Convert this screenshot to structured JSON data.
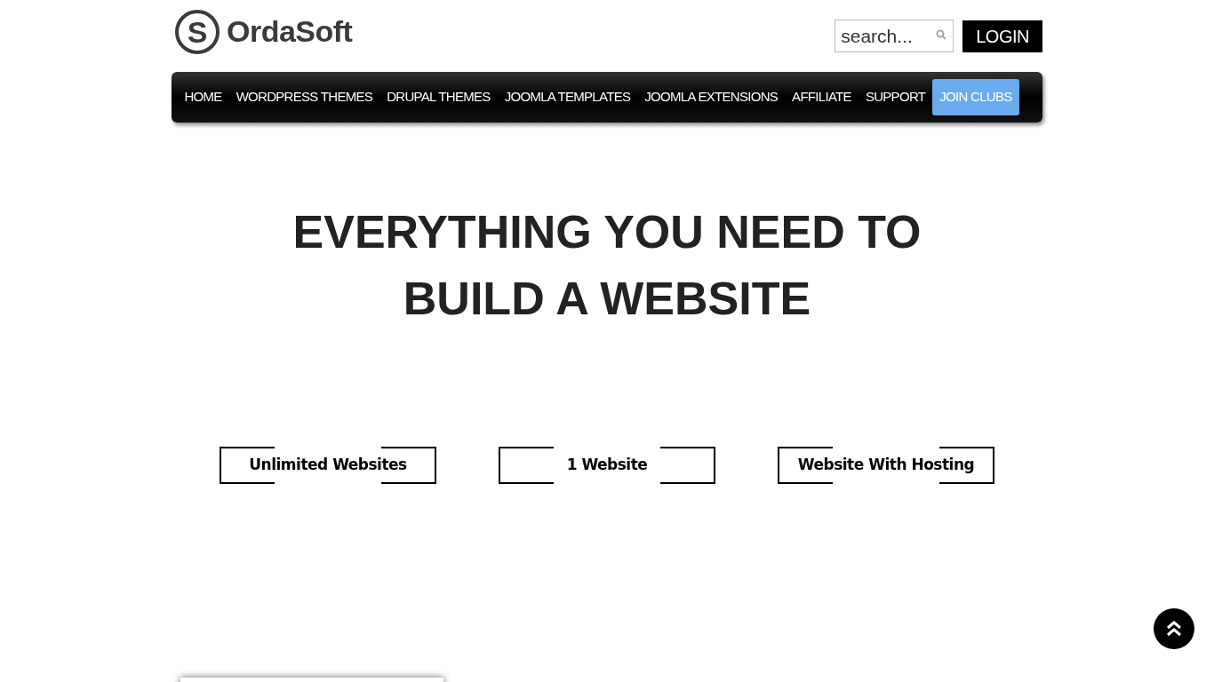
{
  "header": {
    "logo_mark": "S",
    "logo_text": "OrdaSoft",
    "search": {
      "placeholder": "search..."
    },
    "login_button": "LOGIN"
  },
  "nav": [
    {
      "label": "HOME",
      "highlighted": false
    },
    {
      "label": "WORDPRESS THEMES",
      "highlighted": false
    },
    {
      "label": "DRUPAL THEMES",
      "highlighted": false
    },
    {
      "label": "JOOMLA TEMPLATES",
      "highlighted": false
    },
    {
      "label": "JOOMLA EXTENSIONS",
      "highlighted": false
    },
    {
      "label": "AFFILIATE",
      "highlighted": false
    },
    {
      "label": "SUPPORT",
      "highlighted": false
    },
    {
      "label": "JOIN CLUBS",
      "highlighted": true
    }
  ],
  "hero": {
    "lines": [
      "EVERYTHING YOU NEED TO",
      "BUILD A WEBSITE"
    ]
  },
  "plan_tabs": [
    {
      "label": "Unlimited Websites"
    },
    {
      "label": "1 Website"
    },
    {
      "label": "Website With Hosting"
    }
  ]
}
